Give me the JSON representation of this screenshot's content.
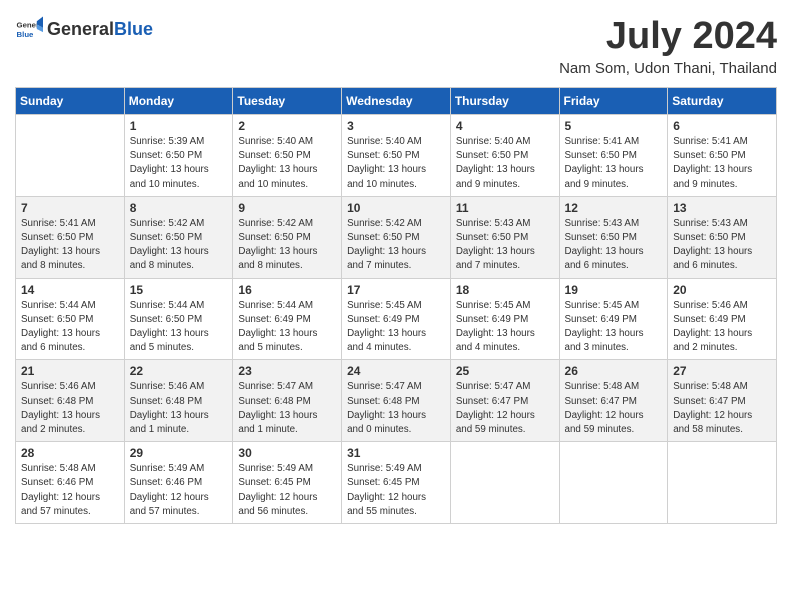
{
  "header": {
    "logo_general": "General",
    "logo_blue": "Blue",
    "month_title": "July 2024",
    "location": "Nam Som, Udon Thani, Thailand"
  },
  "weekdays": [
    "Sunday",
    "Monday",
    "Tuesday",
    "Wednesday",
    "Thursday",
    "Friday",
    "Saturday"
  ],
  "weeks": [
    [
      {
        "day": "",
        "sunrise": "",
        "sunset": "",
        "daylight": ""
      },
      {
        "day": "1",
        "sunrise": "Sunrise: 5:39 AM",
        "sunset": "Sunset: 6:50 PM",
        "daylight": "Daylight: 13 hours and 10 minutes."
      },
      {
        "day": "2",
        "sunrise": "Sunrise: 5:40 AM",
        "sunset": "Sunset: 6:50 PM",
        "daylight": "Daylight: 13 hours and 10 minutes."
      },
      {
        "day": "3",
        "sunrise": "Sunrise: 5:40 AM",
        "sunset": "Sunset: 6:50 PM",
        "daylight": "Daylight: 13 hours and 10 minutes."
      },
      {
        "day": "4",
        "sunrise": "Sunrise: 5:40 AM",
        "sunset": "Sunset: 6:50 PM",
        "daylight": "Daylight: 13 hours and 9 minutes."
      },
      {
        "day": "5",
        "sunrise": "Sunrise: 5:41 AM",
        "sunset": "Sunset: 6:50 PM",
        "daylight": "Daylight: 13 hours and 9 minutes."
      },
      {
        "day": "6",
        "sunrise": "Sunrise: 5:41 AM",
        "sunset": "Sunset: 6:50 PM",
        "daylight": "Daylight: 13 hours and 9 minutes."
      }
    ],
    [
      {
        "day": "7",
        "sunrise": "Sunrise: 5:41 AM",
        "sunset": "Sunset: 6:50 PM",
        "daylight": "Daylight: 13 hours and 8 minutes."
      },
      {
        "day": "8",
        "sunrise": "Sunrise: 5:42 AM",
        "sunset": "Sunset: 6:50 PM",
        "daylight": "Daylight: 13 hours and 8 minutes."
      },
      {
        "day": "9",
        "sunrise": "Sunrise: 5:42 AM",
        "sunset": "Sunset: 6:50 PM",
        "daylight": "Daylight: 13 hours and 8 minutes."
      },
      {
        "day": "10",
        "sunrise": "Sunrise: 5:42 AM",
        "sunset": "Sunset: 6:50 PM",
        "daylight": "Daylight: 13 hours and 7 minutes."
      },
      {
        "day": "11",
        "sunrise": "Sunrise: 5:43 AM",
        "sunset": "Sunset: 6:50 PM",
        "daylight": "Daylight: 13 hours and 7 minutes."
      },
      {
        "day": "12",
        "sunrise": "Sunrise: 5:43 AM",
        "sunset": "Sunset: 6:50 PM",
        "daylight": "Daylight: 13 hours and 6 minutes."
      },
      {
        "day": "13",
        "sunrise": "Sunrise: 5:43 AM",
        "sunset": "Sunset: 6:50 PM",
        "daylight": "Daylight: 13 hours and 6 minutes."
      }
    ],
    [
      {
        "day": "14",
        "sunrise": "Sunrise: 5:44 AM",
        "sunset": "Sunset: 6:50 PM",
        "daylight": "Daylight: 13 hours and 6 minutes."
      },
      {
        "day": "15",
        "sunrise": "Sunrise: 5:44 AM",
        "sunset": "Sunset: 6:50 PM",
        "daylight": "Daylight: 13 hours and 5 minutes."
      },
      {
        "day": "16",
        "sunrise": "Sunrise: 5:44 AM",
        "sunset": "Sunset: 6:49 PM",
        "daylight": "Daylight: 13 hours and 5 minutes."
      },
      {
        "day": "17",
        "sunrise": "Sunrise: 5:45 AM",
        "sunset": "Sunset: 6:49 PM",
        "daylight": "Daylight: 13 hours and 4 minutes."
      },
      {
        "day": "18",
        "sunrise": "Sunrise: 5:45 AM",
        "sunset": "Sunset: 6:49 PM",
        "daylight": "Daylight: 13 hours and 4 minutes."
      },
      {
        "day": "19",
        "sunrise": "Sunrise: 5:45 AM",
        "sunset": "Sunset: 6:49 PM",
        "daylight": "Daylight: 13 hours and 3 minutes."
      },
      {
        "day": "20",
        "sunrise": "Sunrise: 5:46 AM",
        "sunset": "Sunset: 6:49 PM",
        "daylight": "Daylight: 13 hours and 2 minutes."
      }
    ],
    [
      {
        "day": "21",
        "sunrise": "Sunrise: 5:46 AM",
        "sunset": "Sunset: 6:48 PM",
        "daylight": "Daylight: 13 hours and 2 minutes."
      },
      {
        "day": "22",
        "sunrise": "Sunrise: 5:46 AM",
        "sunset": "Sunset: 6:48 PM",
        "daylight": "Daylight: 13 hours and 1 minute."
      },
      {
        "day": "23",
        "sunrise": "Sunrise: 5:47 AM",
        "sunset": "Sunset: 6:48 PM",
        "daylight": "Daylight: 13 hours and 1 minute."
      },
      {
        "day": "24",
        "sunrise": "Sunrise: 5:47 AM",
        "sunset": "Sunset: 6:48 PM",
        "daylight": "Daylight: 13 hours and 0 minutes."
      },
      {
        "day": "25",
        "sunrise": "Sunrise: 5:47 AM",
        "sunset": "Sunset: 6:47 PM",
        "daylight": "Daylight: 12 hours and 59 minutes."
      },
      {
        "day": "26",
        "sunrise": "Sunrise: 5:48 AM",
        "sunset": "Sunset: 6:47 PM",
        "daylight": "Daylight: 12 hours and 59 minutes."
      },
      {
        "day": "27",
        "sunrise": "Sunrise: 5:48 AM",
        "sunset": "Sunset: 6:47 PM",
        "daylight": "Daylight: 12 hours and 58 minutes."
      }
    ],
    [
      {
        "day": "28",
        "sunrise": "Sunrise: 5:48 AM",
        "sunset": "Sunset: 6:46 PM",
        "daylight": "Daylight: 12 hours and 57 minutes."
      },
      {
        "day": "29",
        "sunrise": "Sunrise: 5:49 AM",
        "sunset": "Sunset: 6:46 PM",
        "daylight": "Daylight: 12 hours and 57 minutes."
      },
      {
        "day": "30",
        "sunrise": "Sunrise: 5:49 AM",
        "sunset": "Sunset: 6:45 PM",
        "daylight": "Daylight: 12 hours and 56 minutes."
      },
      {
        "day": "31",
        "sunrise": "Sunrise: 5:49 AM",
        "sunset": "Sunset: 6:45 PM",
        "daylight": "Daylight: 12 hours and 55 minutes."
      },
      {
        "day": "",
        "sunrise": "",
        "sunset": "",
        "daylight": ""
      },
      {
        "day": "",
        "sunrise": "",
        "sunset": "",
        "daylight": ""
      },
      {
        "day": "",
        "sunrise": "",
        "sunset": "",
        "daylight": ""
      }
    ]
  ]
}
